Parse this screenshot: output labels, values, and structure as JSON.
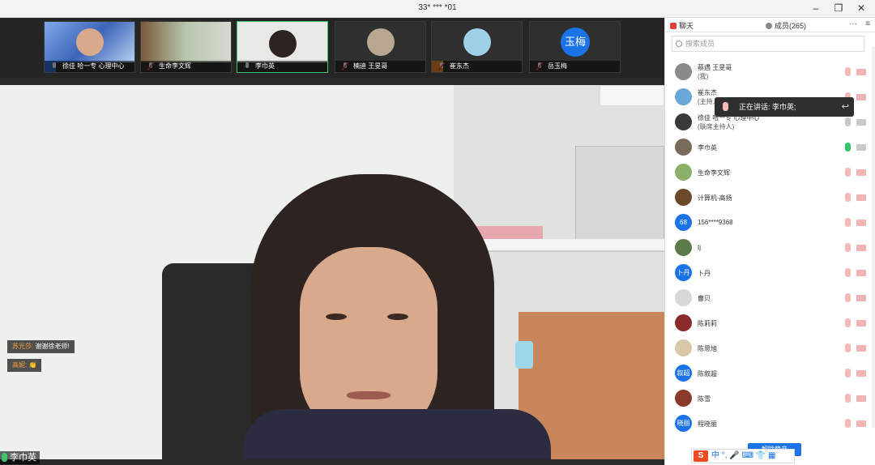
{
  "window": {
    "title": "33* *** *01",
    "min_glyph": "–",
    "restore_glyph": "❐",
    "close_glyph": "✕"
  },
  "thumbnails": [
    {
      "name": "徐佳 哈一专 心理中心",
      "active": false,
      "has_role": true
    },
    {
      "name": "生命李文辉",
      "active": false,
      "has_role": false
    },
    {
      "name": "李巾英",
      "active": true,
      "has_role": false
    },
    {
      "name": "楠迪 王旻哥",
      "active": false,
      "has_role": false
    },
    {
      "name": "崔东杰",
      "active": false,
      "has_role": true
    },
    {
      "name": "岳玉梅",
      "active": false,
      "has_role": false,
      "avatar_text": "玉梅"
    }
  ],
  "chat_overlay": [
    {
      "who": "苏光莎:",
      "text": "谢谢徐老师!"
    },
    {
      "who": "高妮:",
      "text": "👏"
    }
  ],
  "speaker": {
    "name": "李巾英"
  },
  "panel": {
    "tab_chat": "聊天",
    "tab_members": "成员(265)",
    "more_glyph": "···",
    "menu_glyph": "≡",
    "search_placeholder": "搜索成员"
  },
  "members": [
    {
      "name": "蔡遇 王旻哥",
      "sub": "(我)",
      "avatar_text": "",
      "avatar_color": "#8a8a8a",
      "mic": "off",
      "cam": "off"
    },
    {
      "name": "崔东杰",
      "sub": "(主持人)",
      "avatar_text": "",
      "avatar_color": "#6aa8d8",
      "mic": "off",
      "cam": "off"
    },
    {
      "name": "徐佳 哈一专 心理中心",
      "sub": "(联席主持人)",
      "avatar_text": "",
      "avatar_color": "#3a3a3a",
      "mic": "grey",
      "cam": "grey"
    },
    {
      "name": "李巾英",
      "sub": "",
      "avatar_text": "",
      "avatar_color": "#7a6a5a",
      "mic": "on",
      "cam": "grey"
    },
    {
      "name": "生命李文辉",
      "sub": "",
      "avatar_text": "",
      "avatar_color": "#8ab06a",
      "mic": "off",
      "cam": "off"
    },
    {
      "name": "计算机-高扬",
      "sub": "",
      "avatar_text": "",
      "avatar_color": "#6a4a2a",
      "mic": "off",
      "cam": "off"
    },
    {
      "name": "156****9368",
      "sub": "",
      "avatar_text": "68",
      "avatar_color": "#1a73e8",
      "mic": "off",
      "cam": "off"
    },
    {
      "name": "tj",
      "sub": "",
      "avatar_text": "",
      "avatar_color": "#5a7a4a",
      "mic": "off",
      "cam": "off"
    },
    {
      "name": "卜丹",
      "sub": "",
      "avatar_text": "卜丹",
      "avatar_color": "#1a73e8",
      "mic": "off",
      "cam": "off"
    },
    {
      "name": "曹贝",
      "sub": "",
      "avatar_text": "",
      "avatar_color": "#d8d8d8",
      "mic": "off",
      "cam": "off"
    },
    {
      "name": "陈莉莉",
      "sub": "",
      "avatar_text": "",
      "avatar_color": "#8a2a2a",
      "mic": "off",
      "cam": "off"
    },
    {
      "name": "陈思旭",
      "sub": "",
      "avatar_text": "",
      "avatar_color": "#d8c8a8",
      "mic": "off",
      "cam": "off"
    },
    {
      "name": "陈叙超",
      "sub": "",
      "avatar_text": "叙超",
      "avatar_color": "#1a73e8",
      "mic": "off",
      "cam": "off"
    },
    {
      "name": "陈雪",
      "sub": "",
      "avatar_text": "",
      "avatar_color": "#8a3a2a",
      "mic": "off",
      "cam": "off"
    },
    {
      "name": "程晓丽",
      "sub": "",
      "avatar_text": "晓丽",
      "avatar_color": "#1a73e8",
      "mic": "off",
      "cam": "off"
    }
  ],
  "speaking_popup": {
    "text": "正在讲话: 李巾英;",
    "back_glyph": "↩"
  },
  "unmute_button": "解除静音",
  "ime": {
    "logo": "S",
    "text": "中 °, 🎤 ⌨ 👕 ▦"
  }
}
